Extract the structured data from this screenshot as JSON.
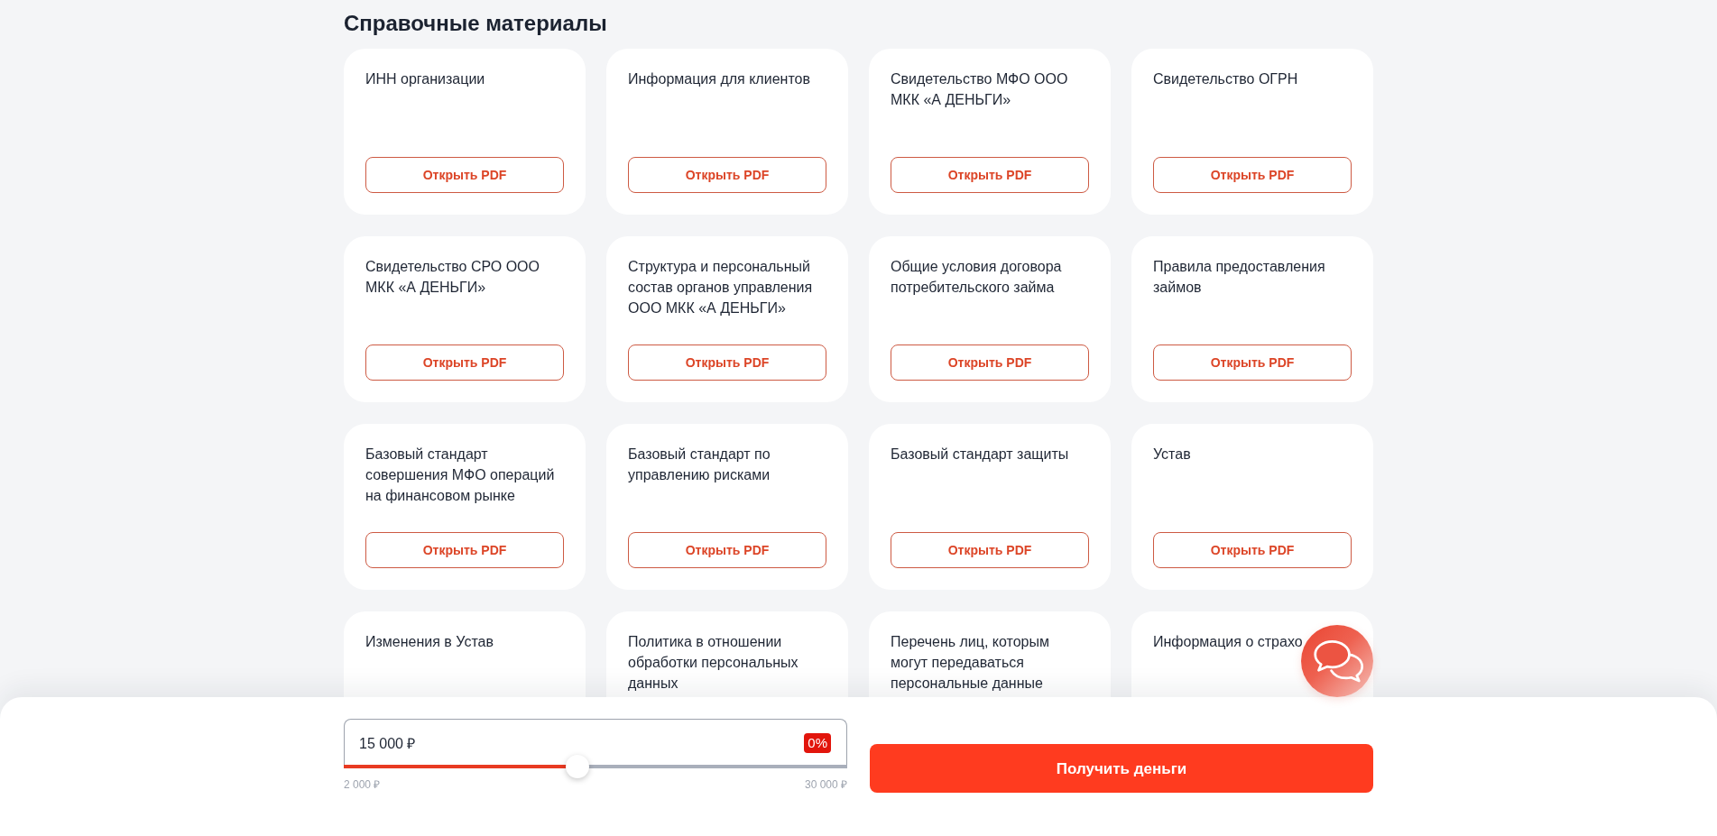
{
  "section": {
    "title": "Справочные материалы"
  },
  "documents": [
    {
      "title": "ИНН организации",
      "button": "Открыть PDF"
    },
    {
      "title": "Информация для клиентов",
      "button": "Открыть PDF"
    },
    {
      "title": "Свидетельство МФО ООО МКК «А ДЕНЬГИ»",
      "button": "Открыть PDF"
    },
    {
      "title": "Свидетельство ОГРН",
      "button": "Открыть PDF"
    },
    {
      "title": "Свидетельство СРО ООО МКК «А ДЕНЬГИ»",
      "button": "Открыть PDF"
    },
    {
      "title": "Структура и персональный состав органов управления ООО МКК «А ДЕНЬГИ»",
      "button": "Открыть PDF"
    },
    {
      "title": "Общие условия договора потребительского займа",
      "button": "Открыть PDF"
    },
    {
      "title": "Правила предоставления займов",
      "button": "Открыть PDF"
    },
    {
      "title": "Базовый стандарт совершения МФО операций на финансовом рынке",
      "button": "Открыть PDF"
    },
    {
      "title": "Базовый стандарт по управлению рисками",
      "button": "Открыть PDF"
    },
    {
      "title": "Базовый стандарт защиты",
      "button": "Открыть PDF"
    },
    {
      "title": "Устав",
      "button": "Открыть PDF"
    },
    {
      "title": "Изменения в Устав"
    },
    {
      "title": "Политика в отношении обработки персональных данных"
    },
    {
      "title": "Перечень лиц, которым могут передаваться персональные данные"
    },
    {
      "title": "Информация о страхо"
    }
  ],
  "loan_form": {
    "amount": "15 000 ₽",
    "discount_badge": "0%",
    "slider": {
      "level": 0.464,
      "min_label": "2 000 ₽",
      "max_label": "30 000 ₽"
    },
    "submit_button": "Получить деньги"
  }
}
